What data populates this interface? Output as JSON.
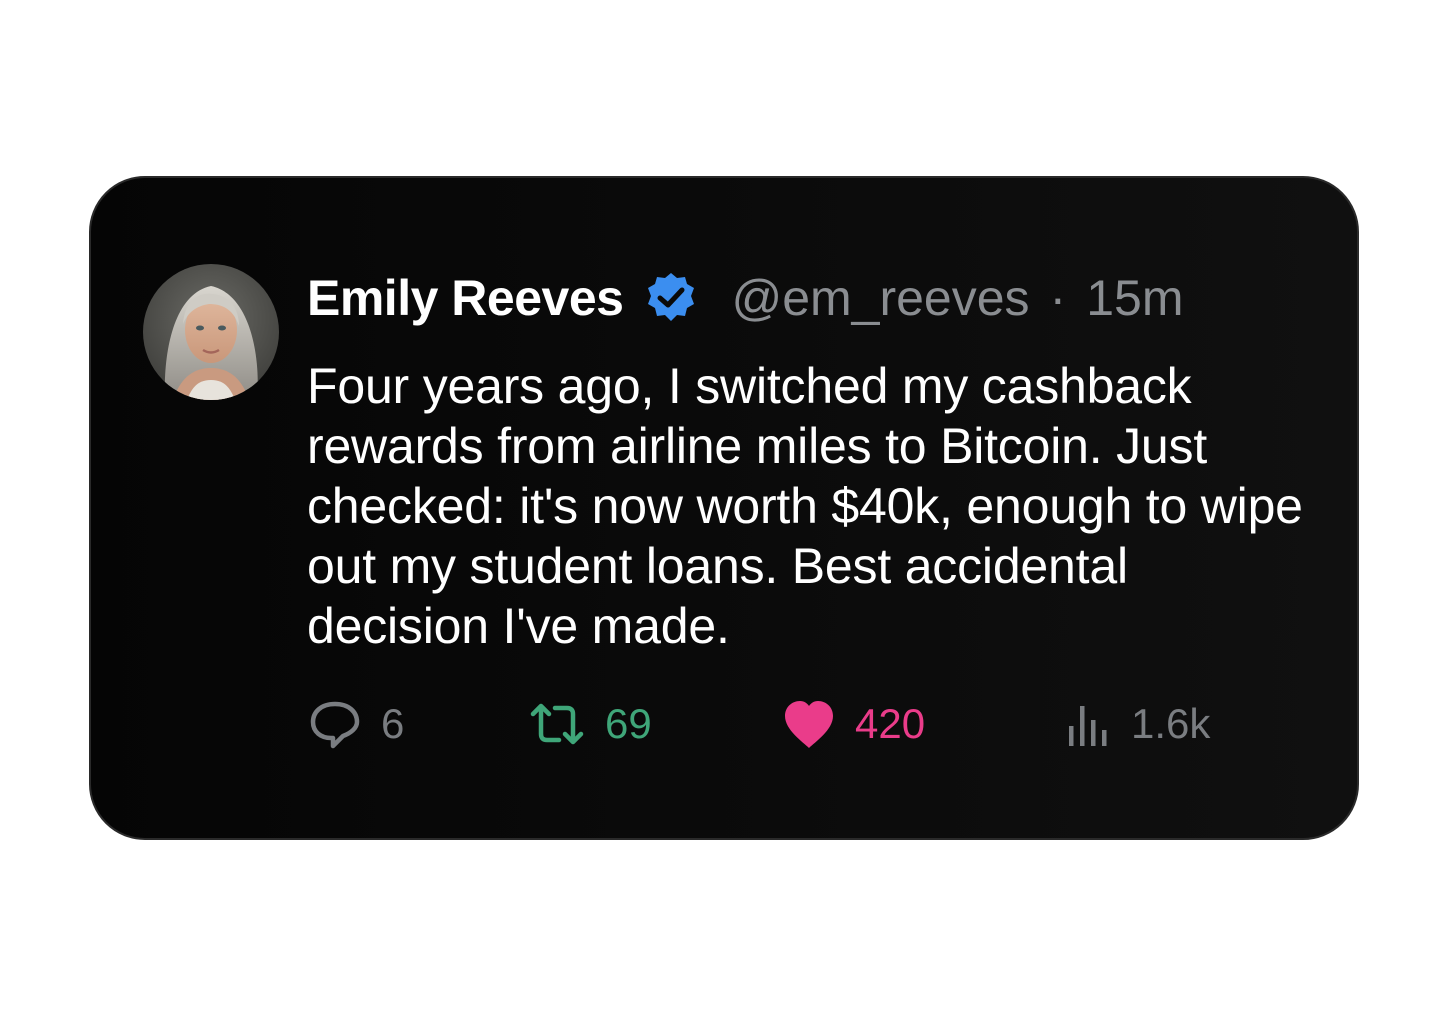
{
  "tweet": {
    "author": {
      "name": "Emily Reeves",
      "handle": "@em_reeves",
      "verified": true,
      "avatar": "woman-portrait-avatar"
    },
    "separator": "·",
    "timestamp": "15m",
    "text": "Four years ago, I switched my cashback rewards from airline miles to Bitcoin. Just checked: it's now worth $40k, enough to wipe out my student loans. Best accidental decision I've made.",
    "actions": {
      "reply": {
        "icon": "speech-bubble-icon",
        "count": "6"
      },
      "retweet": {
        "icon": "retweet-icon",
        "count": "69"
      },
      "like": {
        "icon": "heart-icon",
        "count": "420"
      },
      "views": {
        "icon": "bar-chart-icon",
        "count": "1.6k"
      }
    }
  },
  "colors": {
    "card_background": "#0a0a0a",
    "verified_badge": "#3b8ef0",
    "muted_text": "#8a8d91",
    "retweet": "#3fa679",
    "like": "#ea3c8a"
  }
}
